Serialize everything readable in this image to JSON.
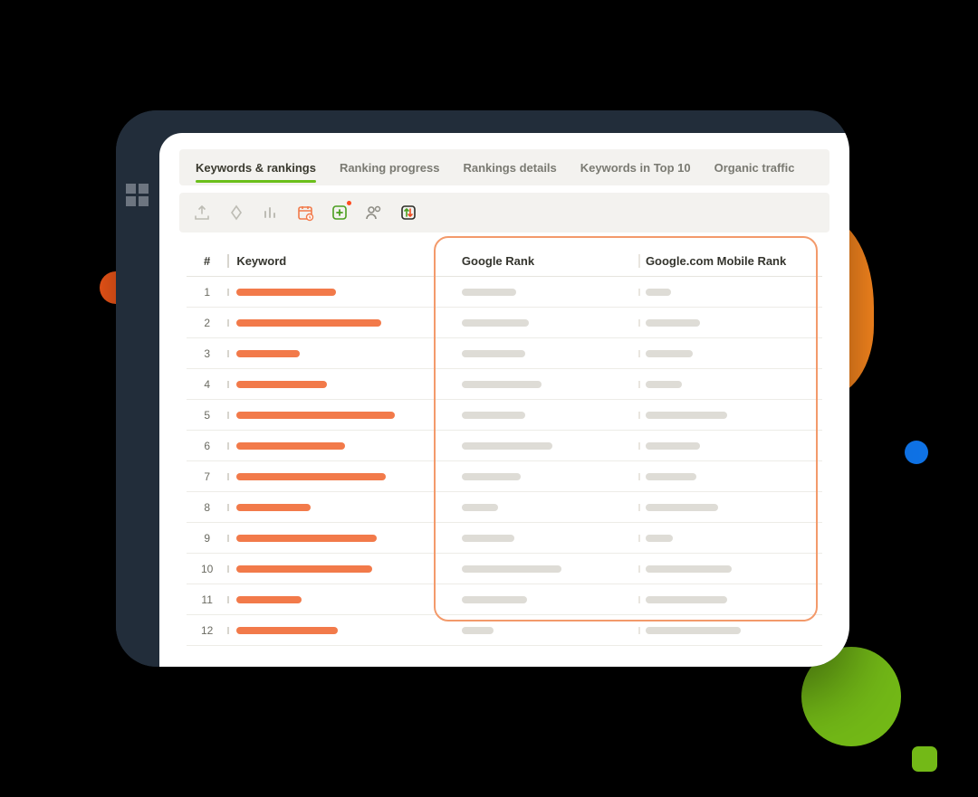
{
  "tabs": [
    {
      "label": "Keywords & rankings",
      "active": true
    },
    {
      "label": "Ranking progress",
      "active": false
    },
    {
      "label": "Rankings details",
      "active": false
    },
    {
      "label": "Keywords in Top 10",
      "active": false
    },
    {
      "label": "Organic traffic",
      "active": false
    }
  ],
  "toolbar_icons": [
    "export-icon",
    "merge-icon",
    "stats-icon",
    "schedule-icon",
    "add-icon",
    "assign-icon",
    "sort-icon"
  ],
  "columns": {
    "index": "#",
    "keyword": "Keyword",
    "google": "Google Rank",
    "mobile": "Google.com Mobile Rank"
  },
  "rows": [
    {
      "n": 1,
      "kw": 110,
      "g": 60,
      "m": 28
    },
    {
      "n": 2,
      "kw": 160,
      "g": 74,
      "m": 60
    },
    {
      "n": 3,
      "kw": 70,
      "g": 70,
      "m": 52
    },
    {
      "n": 4,
      "kw": 100,
      "g": 88,
      "m": 40
    },
    {
      "n": 5,
      "kw": 175,
      "g": 70,
      "m": 90
    },
    {
      "n": 6,
      "kw": 120,
      "g": 100,
      "m": 60
    },
    {
      "n": 7,
      "kw": 165,
      "g": 65,
      "m": 56
    },
    {
      "n": 8,
      "kw": 82,
      "g": 40,
      "m": 80
    },
    {
      "n": 9,
      "kw": 155,
      "g": 58,
      "m": 30
    },
    {
      "n": 10,
      "kw": 150,
      "g": 110,
      "m": 95
    },
    {
      "n": 11,
      "kw": 72,
      "g": 72,
      "m": 90
    },
    {
      "n": 12,
      "kw": 112,
      "g": 35,
      "m": 105
    }
  ],
  "colors": {
    "accent": "#f27a4a",
    "green": "#6bbf1b",
    "highlight": "#f39a6b"
  }
}
